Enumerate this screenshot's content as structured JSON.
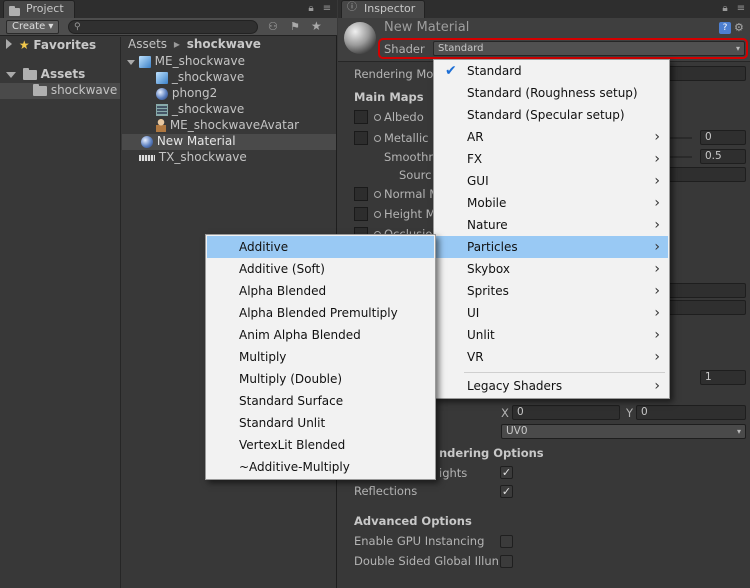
{
  "project_panel": {
    "tab_label": "Project",
    "create_label": "Create ▾",
    "favorites_label": "Favorites",
    "assets_label": "Assets",
    "shockwave_folder": "shockwave",
    "breadcrumb": {
      "root": "Assets",
      "sep": "▸",
      "current": "shockwave"
    },
    "files": [
      {
        "icon": "cube-icon",
        "label": "ME_shockwave",
        "expanded": true
      },
      {
        "icon": "cube-icon",
        "label": "_shockwave"
      },
      {
        "icon": "sphere-icon",
        "label": "phong2"
      },
      {
        "icon": "mesh-icon",
        "label": "_shockwave"
      },
      {
        "icon": "avatar-icon",
        "label": "ME_shockwaveAvatar"
      },
      {
        "icon": "sphere-icon",
        "label": "New Material",
        "selected": true
      },
      {
        "icon": "texture-icon",
        "label": "TX_shockwave"
      }
    ]
  },
  "inspector": {
    "tab_label": "Inspector",
    "material_name": "New Material",
    "shader_label": "Shader",
    "shader_value": "Standard",
    "rendering_mode_label": "Rendering Mo",
    "main_maps_label": "Main Maps",
    "albedo_label": "Albedo",
    "metallic_label": "Metallic",
    "metallic_value": "0",
    "smoothness_label": "Smoothn",
    "smoothness_value": "0.5",
    "source_label": "Sourc",
    "normal_label": "Normal M",
    "height_label": "Height M",
    "occlusion_label": "Occlusio",
    "emission_value": "1",
    "x_label": "X",
    "x_value": "0",
    "y_label": "Y",
    "y_value": "0",
    "uv_value": "UV0",
    "rendering_options_label": "ndering Options",
    "highlights_label": "ights",
    "reflections_label": "Reflections",
    "advanced_label": "Advanced Options",
    "gpu_instancing_label": "Enable GPU Instancing",
    "double_sided_label": "Double Sided Global Illun"
  },
  "shader_menu": {
    "items": [
      {
        "label": "Standard",
        "checked": true,
        "submenu": false
      },
      {
        "label": "Standard (Roughness setup)",
        "submenu": false
      },
      {
        "label": "Standard (Specular setup)",
        "submenu": false
      },
      {
        "label": "AR",
        "submenu": true
      },
      {
        "label": "FX",
        "submenu": true
      },
      {
        "label": "GUI",
        "submenu": true
      },
      {
        "label": "Mobile",
        "submenu": true
      },
      {
        "label": "Nature",
        "submenu": true
      },
      {
        "label": "Particles",
        "submenu": true,
        "highlighted": true
      },
      {
        "label": "Skybox",
        "submenu": true
      },
      {
        "label": "Sprites",
        "submenu": true
      },
      {
        "label": "UI",
        "submenu": true
      },
      {
        "label": "Unlit",
        "submenu": true
      },
      {
        "label": "VR",
        "submenu": true
      }
    ],
    "legacy_label": "Legacy Shaders",
    "chevron": "›",
    "check": "✔"
  },
  "particles_menu": {
    "items": [
      {
        "label": "Additive",
        "highlighted": true
      },
      {
        "label": "Additive (Soft)"
      },
      {
        "label": "Alpha Blended"
      },
      {
        "label": "Alpha Blended Premultiply"
      },
      {
        "label": "Anim Alpha Blended"
      },
      {
        "label": "Multiply"
      },
      {
        "label": "Multiply (Double)"
      },
      {
        "label": "Standard Surface"
      },
      {
        "label": "Standard Unlit"
      },
      {
        "label": "VertexLit Blended"
      },
      {
        "label": "~Additive-Multiply"
      }
    ]
  },
  "colors": {
    "highlight": "#99c9f4",
    "shader_outline": "#d40000",
    "panel_bg": "#383838"
  }
}
